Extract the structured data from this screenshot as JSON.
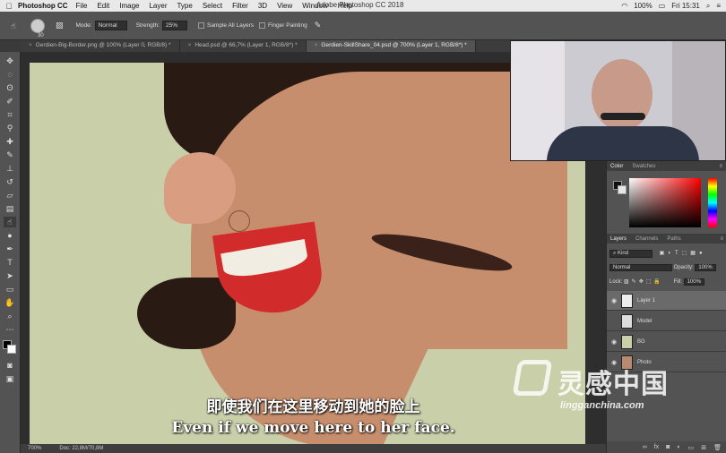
{
  "menubar": {
    "app": "Photoshop CC",
    "items": [
      "File",
      "Edit",
      "Image",
      "Layer",
      "Type",
      "Select",
      "Filter",
      "3D",
      "View",
      "Window",
      "Help"
    ],
    "window_title": "Adobe Photoshop CC 2018",
    "battery": "100%",
    "clock": "Fri 15:31"
  },
  "options": {
    "brush_size": "30",
    "mode_label": "Mode:",
    "mode_value": "Normal",
    "strength_label": "Strength:",
    "strength_value": "25%",
    "sample_all_layers": "Sample All Layers",
    "finger_painting": "Finger Painting"
  },
  "tabs": [
    {
      "label": "Gerdien-Big-Border.png @ 100% (Layer 0, RGB/8) *"
    },
    {
      "label": "Head.psd @ 66,7% (Layer 1, RGB/8*) *"
    },
    {
      "label": "Gerdien-SkillShare_04.psd @ 700% (Layer 1, RGB/8*) *"
    }
  ],
  "status": {
    "zoom": "700%",
    "doc": "Doc: 22,8M/70,8M"
  },
  "subtitles": {
    "zh": "即使我们在这里移动到她的脸上",
    "en": "Even if we move here to her face."
  },
  "color_panel": {
    "tab_color": "Color",
    "tab_swatches": "Swatches"
  },
  "layers_panel": {
    "tab_layers": "Layers",
    "tab_channels": "Channels",
    "tab_paths": "Paths",
    "kind": "Kind",
    "blend_mode": "Normal",
    "opacity_label": "Opacity:",
    "opacity_value": "100%",
    "lock_label": "Lock:",
    "fill_label": "Fill:",
    "fill_value": "100%",
    "layers": [
      {
        "name": "Layer 1",
        "visible": true,
        "selected": true
      },
      {
        "name": "Model",
        "visible": false,
        "selected": false
      },
      {
        "name": "BG",
        "visible": true,
        "selected": false
      },
      {
        "name": "Photo",
        "visible": true,
        "selected": false
      }
    ]
  },
  "watermark": {
    "brand_cn": "灵感中国",
    "url": "lingganchina.com"
  },
  "colors": {
    "canvas_bg": "#c8cfa9",
    "ui_panel": "#535353",
    "accent_red": "#d22b2b"
  }
}
